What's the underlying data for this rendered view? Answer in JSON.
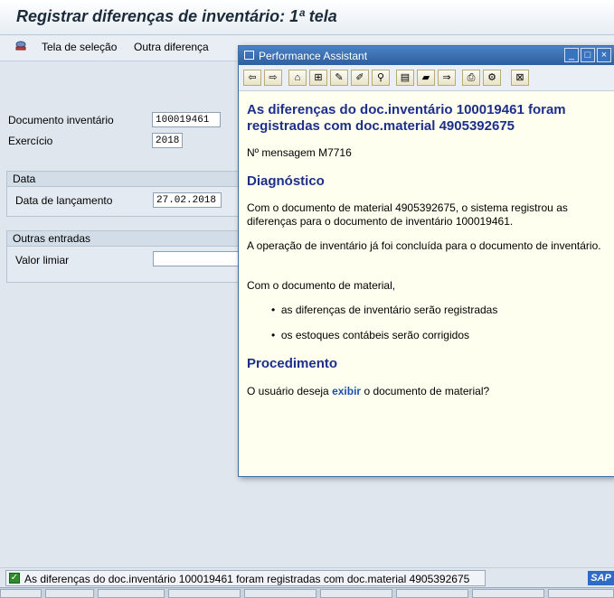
{
  "window": {
    "title": "Registrar diferenças de inventário: 1ª tela"
  },
  "appbar": {
    "items": [
      {
        "label": "Tela de seleção",
        "icon": "selection-screen-icon"
      },
      {
        "label": "Outra diferença"
      }
    ]
  },
  "form": {
    "document": {
      "label": "Documento inventário",
      "value": "100019461"
    },
    "year": {
      "label": "Exercício",
      "value": "2018"
    },
    "data_group": {
      "title": "Data",
      "posting_date": {
        "label": "Data de lançamento",
        "value": "27.02.2018"
      }
    },
    "other_group": {
      "title": "Outras entradas",
      "threshold": {
        "label": "Valor limiar",
        "value": ""
      }
    }
  },
  "assistant": {
    "title": "Performance Assistant",
    "heading": "As diferenças do doc.inventário 100019461 foram registradas com doc.material 4905392675",
    "message_number": "Nº mensagem M7716",
    "diagnosis_title": "Diagnóstico",
    "diagnosis_p1": "Com o documento de material 4905392675, o sistema registrou as diferenças para o documento de inventário 100019461.",
    "diagnosis_p2": "A operação de inventário já foi concluída para o documento de inventário.",
    "diagnosis_p3": "Com o documento de material,",
    "bullets": [
      "as diferenças de inventário serão registradas",
      "os estoques contábeis serão corrigidos"
    ],
    "procedure_title": "Procedimento",
    "procedure_pre": "O usuário deseja",
    "procedure_link": "exibir",
    "procedure_post": "o documento de material?"
  },
  "status": {
    "type": "success",
    "message": "As diferenças do doc.inventário 100019461 foram registradas com doc.material 4905392675"
  },
  "colors": {
    "heading_blue": "#1c2f8a",
    "link_blue": "#1a4fb0",
    "help_background": "#fffff0",
    "success_green": "#2e8b2e"
  }
}
